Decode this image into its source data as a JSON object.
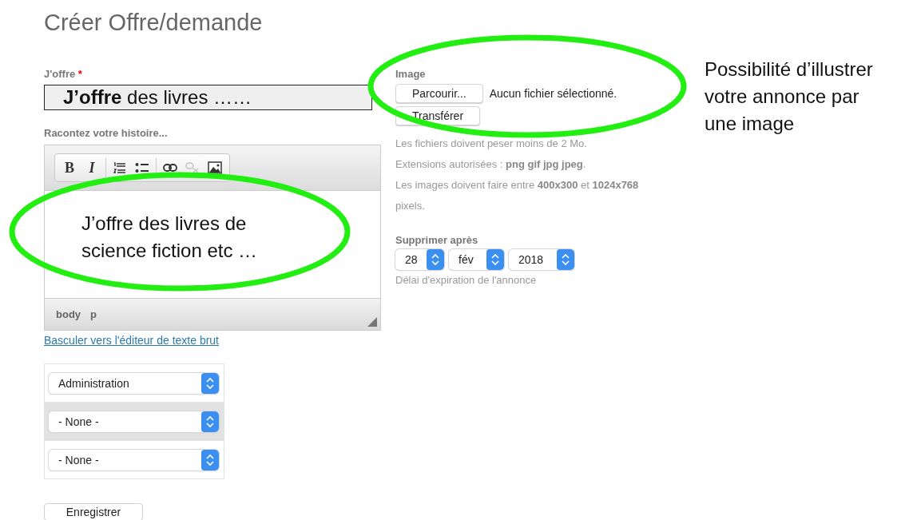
{
  "page": {
    "title": "Créer Offre/demande"
  },
  "offer": {
    "label": "J'offre",
    "required_mark": "*",
    "value": "**J’offre** des livres ……"
  },
  "story": {
    "label": "Racontez votre histoire...",
    "toolbar": [
      {
        "kind": "bold",
        "glyph": "B",
        "disabled": false
      },
      {
        "kind": "italic",
        "glyph": "I",
        "disabled": false
      },
      {
        "kind": "ordered-list",
        "disabled": false
      },
      {
        "kind": "bullet-list",
        "disabled": false
      },
      {
        "kind": "link",
        "disabled": false
      },
      {
        "kind": "unlink",
        "disabled": true
      },
      {
        "kind": "image",
        "disabled": false
      }
    ],
    "content": "J’offre des livres de science fiction etc …",
    "path": [
      "body",
      "p"
    ],
    "switch_link": "Basculer vers l'éditeur de texte brut"
  },
  "categories": [
    {
      "value": "Administration",
      "selected": false
    },
    {
      "value": "- None -",
      "selected": true
    },
    {
      "value": "- None -",
      "selected": false
    }
  ],
  "save_button": "Enregistrer",
  "image": {
    "label": "Image",
    "browse_button": "Parcourir...",
    "file_status": "Aucun fichier sélectionné.",
    "upload_button": "Transférer",
    "help": [
      "Les fichiers doivent peser moins de 2 Mo.",
      "Extensions autorisées : **png gif jpg jpeg**.",
      "Les images doivent faire entre **400x300** et **1024x768** pixels."
    ]
  },
  "expiry": {
    "label": "Supprimer après",
    "day": "28",
    "month": "fév",
    "year": "2018",
    "help": "Délai d'expiration de l'annonce"
  },
  "callout": "Possibilité d’illustrer votre annonce par une image"
}
